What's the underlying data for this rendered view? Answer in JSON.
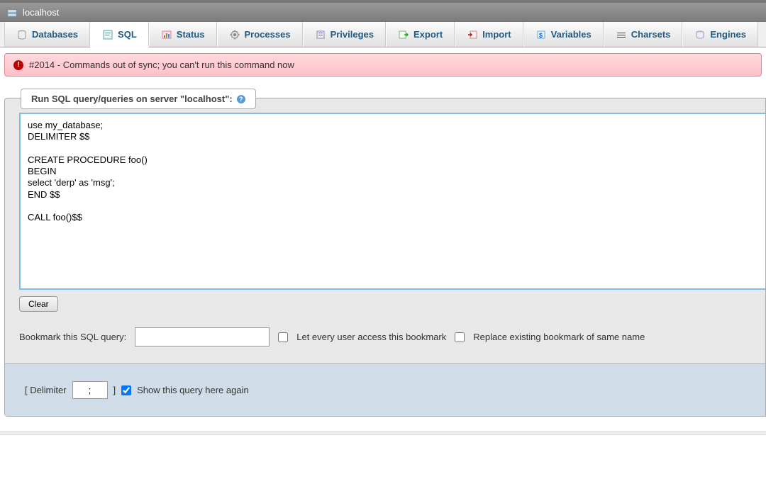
{
  "header": {
    "server_label": "localhost"
  },
  "tabs": [
    {
      "label": "Databases",
      "icon": "databases-icon",
      "active": false
    },
    {
      "label": "SQL",
      "icon": "sql-icon",
      "active": true
    },
    {
      "label": "Status",
      "icon": "status-icon",
      "active": false
    },
    {
      "label": "Processes",
      "icon": "processes-icon",
      "active": false
    },
    {
      "label": "Privileges",
      "icon": "privileges-icon",
      "active": false
    },
    {
      "label": "Export",
      "icon": "export-icon",
      "active": false
    },
    {
      "label": "Import",
      "icon": "import-icon",
      "active": false
    },
    {
      "label": "Variables",
      "icon": "variables-icon",
      "active": false
    },
    {
      "label": "Charsets",
      "icon": "charsets-icon",
      "active": false
    },
    {
      "label": "Engines",
      "icon": "engines-icon",
      "active": false
    }
  ],
  "error": {
    "message": "#2014 - Commands out of sync; you can't run this command now"
  },
  "sqlbox": {
    "title": "Run SQL query/queries on server \"localhost\":",
    "query": "use my_database;\nDELIMITER $$\n\nCREATE PROCEDURE foo()\nBEGIN\nselect 'derp' as 'msg';\nEND $$\n\nCALL foo()$$",
    "clear_label": "Clear",
    "bookmark_label": "Bookmark this SQL query:",
    "bookmark_value": "",
    "let_every_user_label": "Let every user access this bookmark",
    "replace_existing_label": "Replace existing bookmark of same name",
    "delimiter_label_open": "[ Delimiter",
    "delimiter_value": ";",
    "delimiter_label_close": "]",
    "show_again_label": "Show this query here again",
    "show_again_checked": true
  }
}
